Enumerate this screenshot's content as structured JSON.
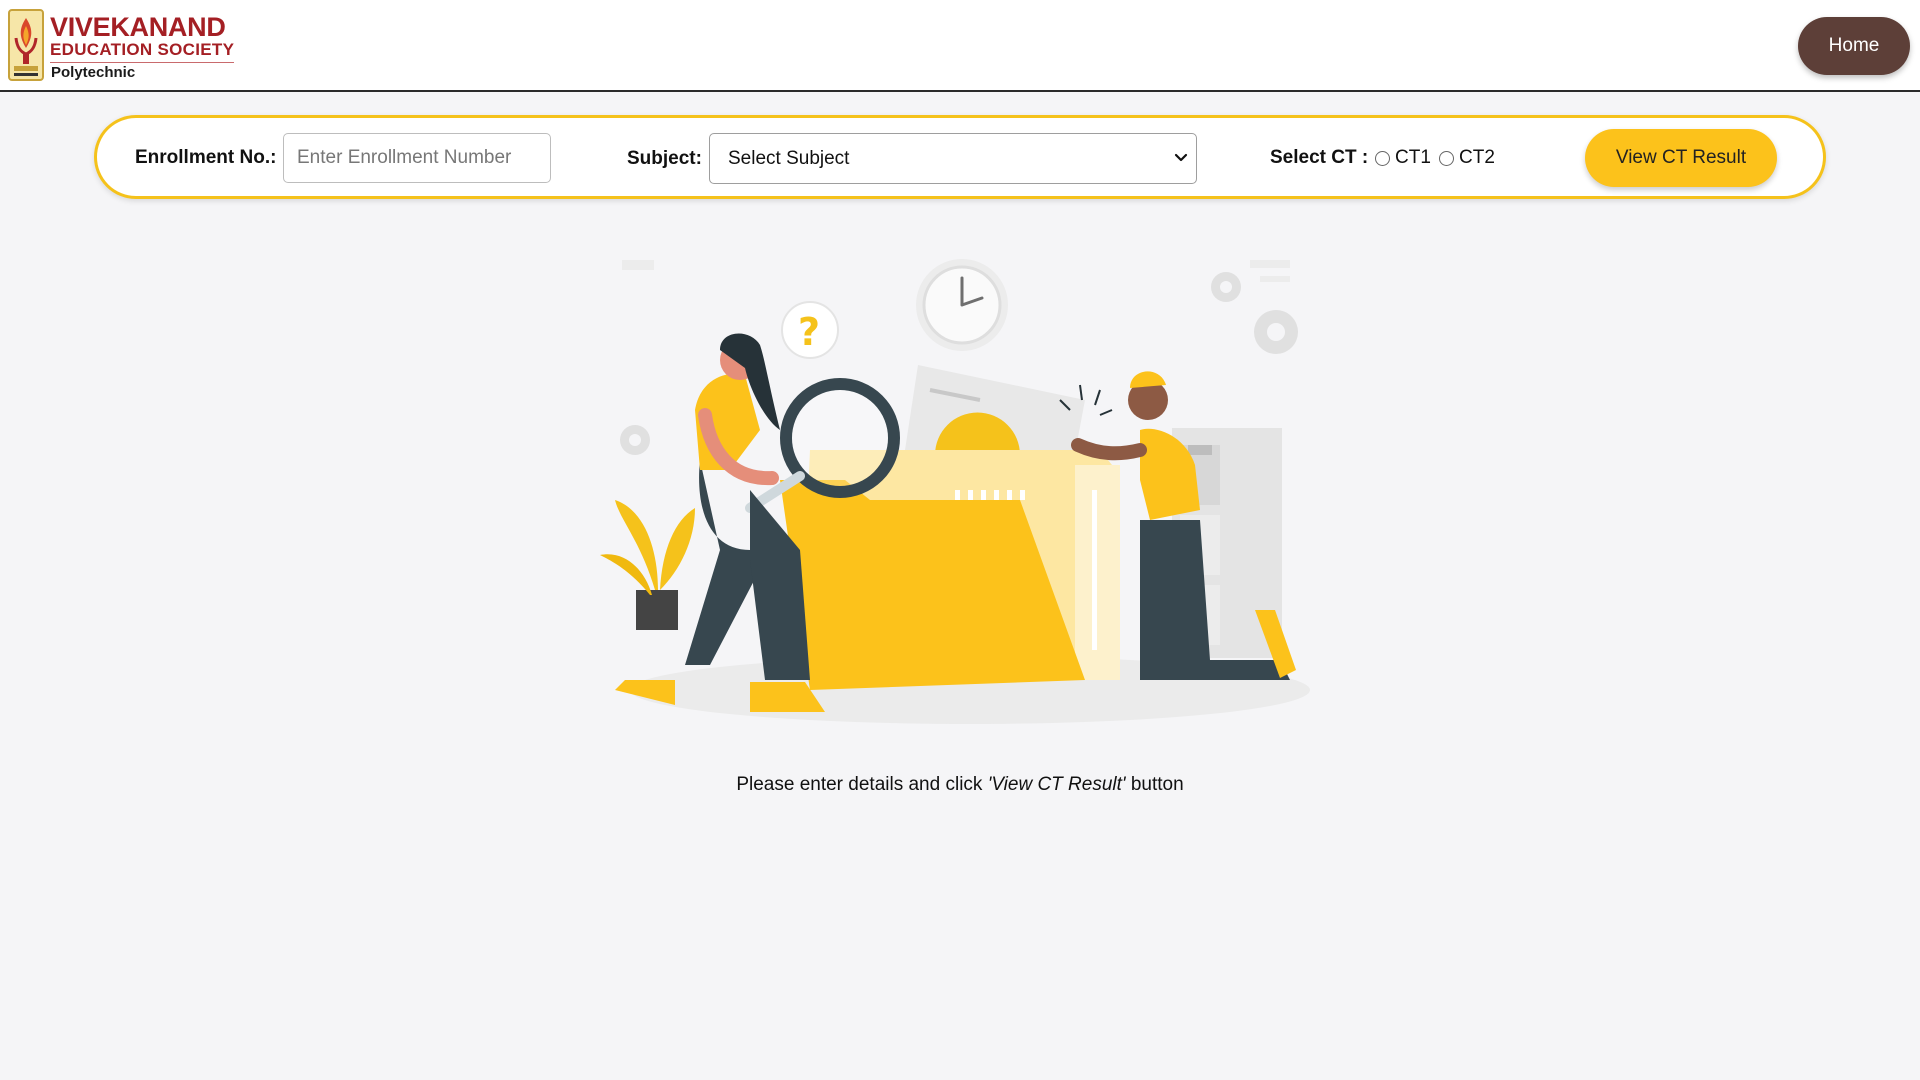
{
  "header": {
    "logo": {
      "title": "VIVEKANAND",
      "subtitle": "EDUCATION SOCIETY",
      "tagline": "Polytechnic"
    },
    "home_label": "Home"
  },
  "form": {
    "enrollment_label": "Enrollment No.:",
    "enrollment_placeholder": "Enter Enrollment Number",
    "enrollment_value": "",
    "subject_label": "Subject:",
    "subject_selected": "Select Subject",
    "ct_label": "Select CT :",
    "ct_options": [
      {
        "label": "CT1",
        "checked": false
      },
      {
        "label": "CT2",
        "checked": false
      }
    ],
    "submit_label": "View CT Result"
  },
  "hint": {
    "prefix": "Please enter details and click ",
    "emphasis": "'View CT Result'",
    "suffix": " button"
  },
  "colors": {
    "accent_yellow": "#fcc21b",
    "home_brown": "#5d3f38",
    "brand_red": "#a41f24",
    "page_bg": "#f5f5f7"
  },
  "icons": {
    "logo": "ves-torch-emblem",
    "select_caret": "chevron-down-icon",
    "illustration": "searching-files-illustration"
  }
}
